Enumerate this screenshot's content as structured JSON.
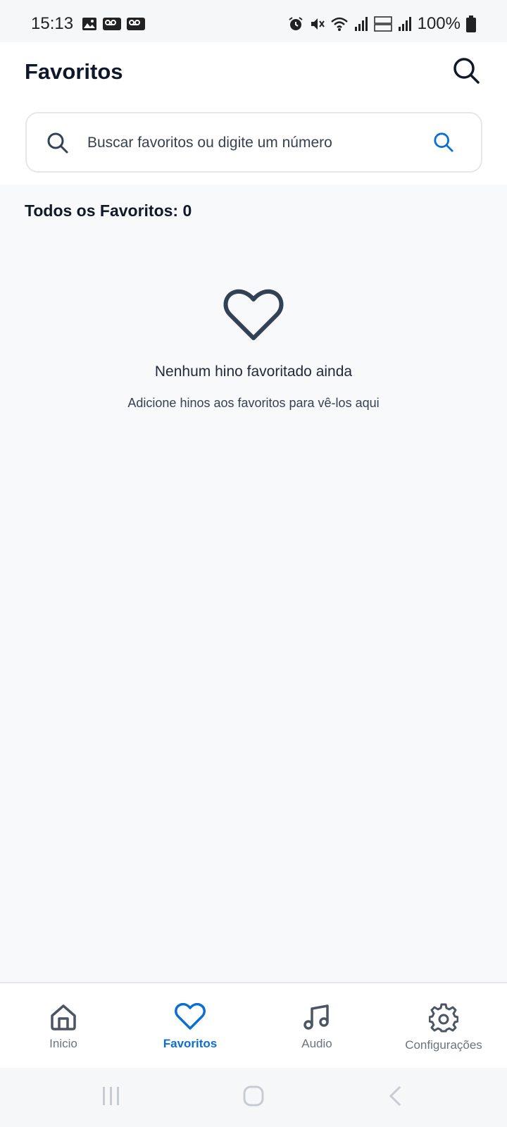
{
  "status": {
    "time": "15:13",
    "battery": "100%"
  },
  "header": {
    "title": "Favoritos",
    "search_icon": "search-icon"
  },
  "search": {
    "placeholder": "Buscar favoritos ou digite um número",
    "value": ""
  },
  "list": {
    "count_label": "Todos os Favoritos: 0"
  },
  "empty_state": {
    "icon": "heart-outline-icon",
    "title": "Nenhum hino favoritado ainda",
    "subtitle": "Adicione hinos aos favoritos para vê-los aqui"
  },
  "nav": {
    "items": [
      {
        "label": "Inicio",
        "icon": "home-icon",
        "active": false
      },
      {
        "label": "Favoritos",
        "icon": "heart-icon",
        "active": true
      },
      {
        "label": "Audio",
        "icon": "music-note-icon",
        "active": false
      },
      {
        "label": "Configurações",
        "icon": "gear-icon",
        "active": false
      }
    ]
  },
  "colors": {
    "accent": "#0b6fd1",
    "text_dark": "#0f172a",
    "icon_dark": "#334155",
    "background": "#f8f9fb"
  }
}
